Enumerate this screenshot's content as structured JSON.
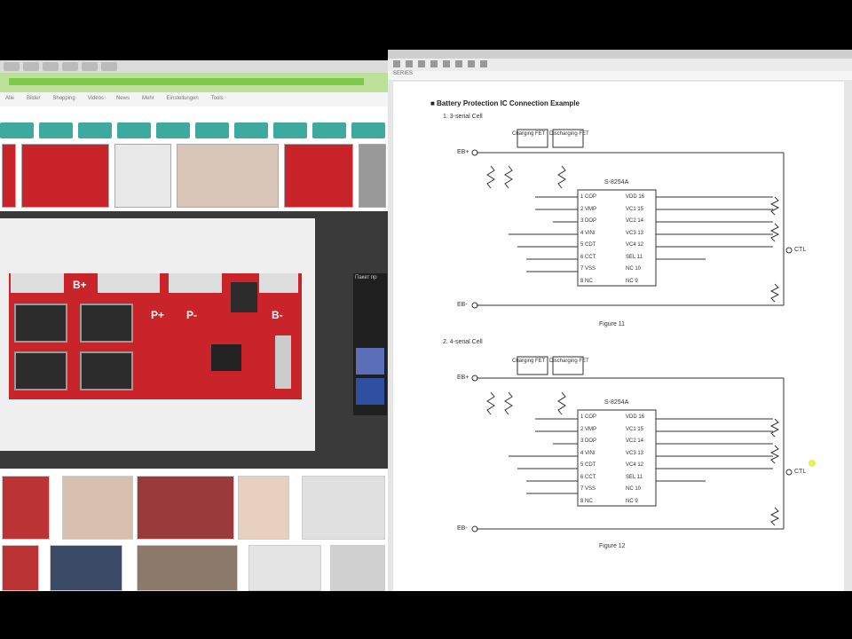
{
  "left_pane": {
    "nav": [
      "Alle",
      "Bilder",
      "Shopping",
      "Videos",
      "News",
      "Mehr",
      "Einstellungen",
      "Tools"
    ],
    "board_labels": {
      "b_plus": "B+",
      "p_plus": "P+",
      "p_minus": "P-",
      "b_minus": "B-"
    },
    "side_panel_title": "Пакет пр"
  },
  "right_pane": {
    "page_label": "SERIES",
    "doc": {
      "section_title": "■ Battery Protection IC Connection Example",
      "example1": {
        "label": "1.  3-serial Cell",
        "ic_name": "S-8254A",
        "figure": "Figure 11"
      },
      "example2": {
        "label": "2.  4-serial Cell",
        "ic_name": "S-8254A",
        "figure": "Figure 12"
      },
      "fet_labels": {
        "charge": "Charging FET",
        "discharge": "Discharging FET"
      },
      "pins_left": [
        "1  COP",
        "2  VMP",
        "3  DOP",
        "4  VINI",
        "5  CDT",
        "6  CCT",
        "7  VSS",
        "8  NC"
      ],
      "pins_right": [
        "VDD 16",
        "VC1 15",
        "VC2 14",
        "VC3 13",
        "VC4 12",
        "SEL 11",
        "NC 10",
        "NC 9"
      ],
      "terminals": {
        "ebplus": "EB+",
        "ebminus": "EB-",
        "ctl": "CTL"
      }
    }
  },
  "colors": {
    "pcb_red": "#c8242a",
    "chip_teal": "#3ea99f",
    "browser_green": "#7dc94a"
  }
}
